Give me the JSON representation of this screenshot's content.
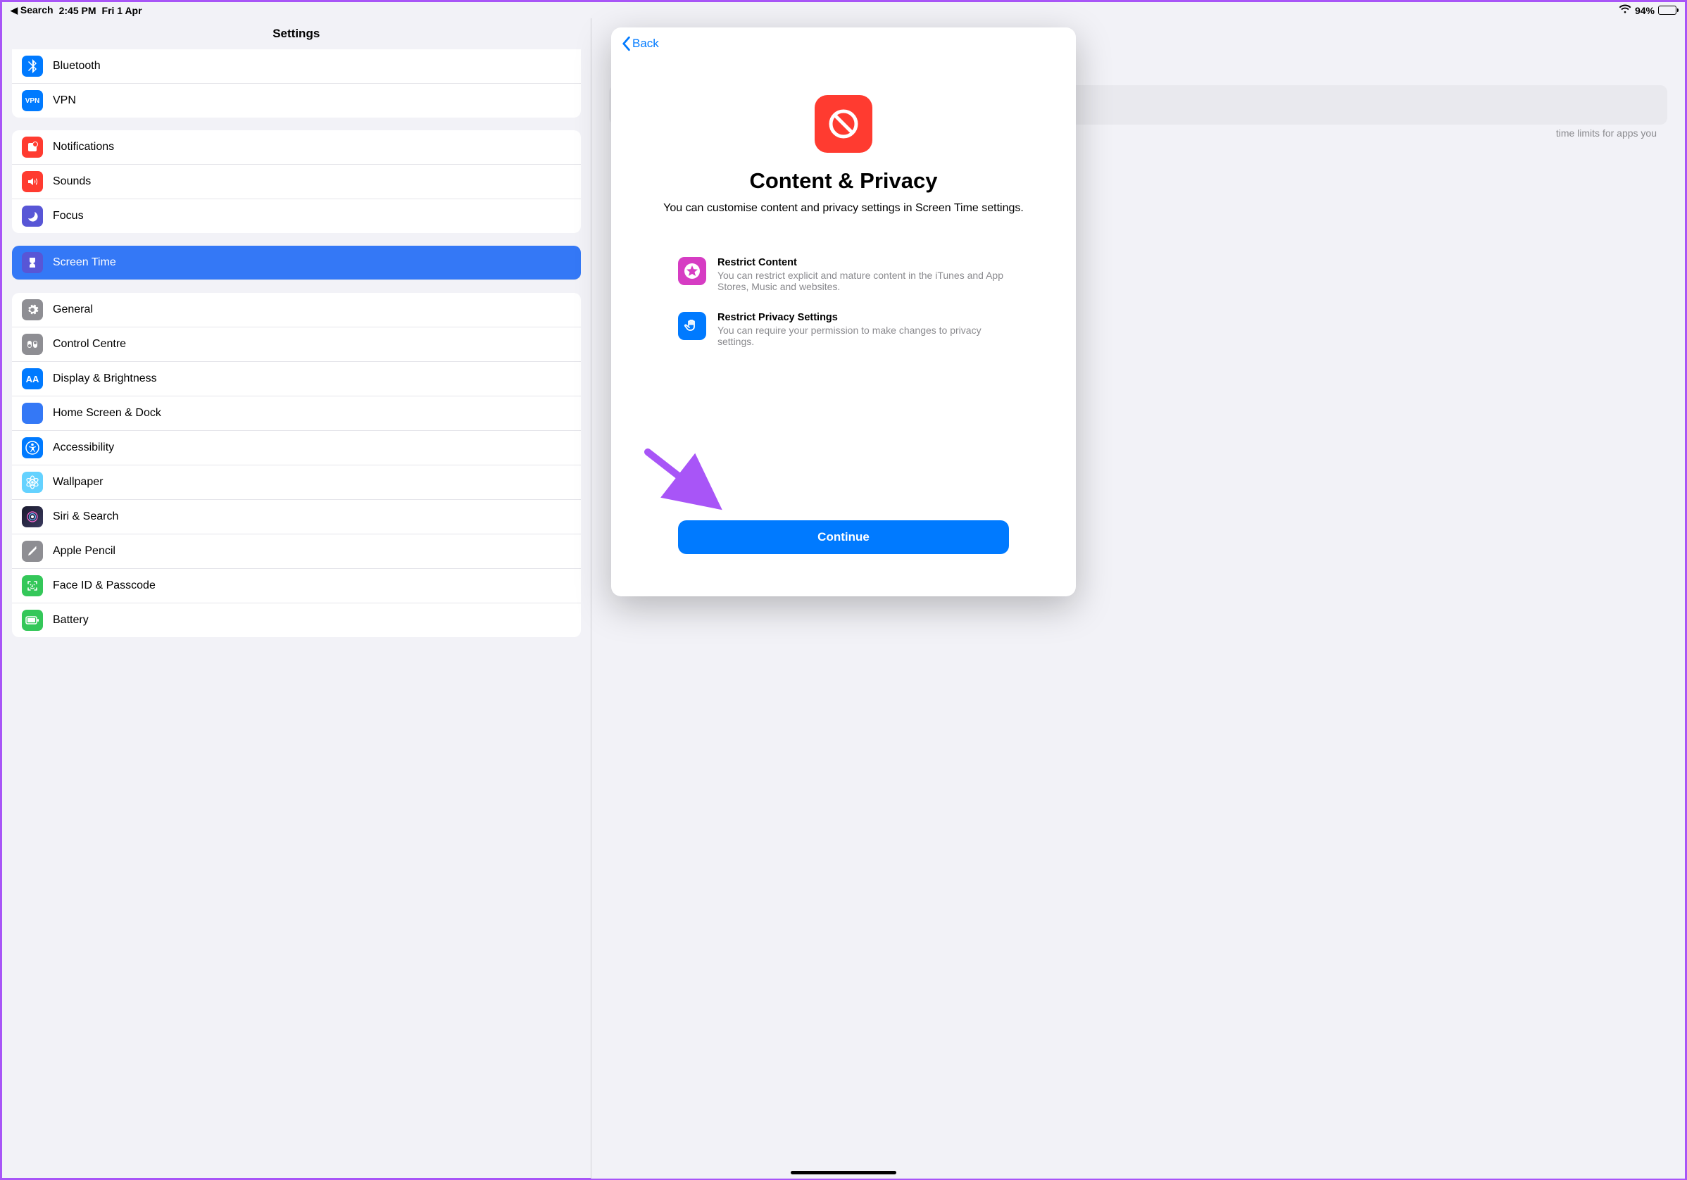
{
  "status": {
    "back_app": "Search",
    "time": "2:45 PM",
    "date": "Fri 1 Apr",
    "battery_pct": "94%"
  },
  "sidebar": {
    "title": "Settings",
    "group1": [
      {
        "label": "Bluetooth",
        "icon": "bluetooth"
      },
      {
        "label": "VPN",
        "icon": "vpn"
      }
    ],
    "group2": [
      {
        "label": "Notifications",
        "icon": "notifications"
      },
      {
        "label": "Sounds",
        "icon": "sounds"
      },
      {
        "label": "Focus",
        "icon": "focus"
      },
      {
        "label": "Screen Time",
        "icon": "screentime",
        "selected": true
      }
    ],
    "group3": [
      {
        "label": "General",
        "icon": "general"
      },
      {
        "label": "Control Centre",
        "icon": "controlcentre"
      },
      {
        "label": "Display & Brightness",
        "icon": "display"
      },
      {
        "label": "Home Screen & Dock",
        "icon": "homescreen"
      },
      {
        "label": "Accessibility",
        "icon": "accessibility"
      },
      {
        "label": "Wallpaper",
        "icon": "wallpaper"
      },
      {
        "label": "Siri & Search",
        "icon": "siri"
      },
      {
        "label": "Apple Pencil",
        "icon": "pencil"
      },
      {
        "label": "Face ID & Passcode",
        "icon": "faceid"
      },
      {
        "label": "Battery",
        "icon": "battery"
      }
    ]
  },
  "detail_bg": {
    "hint_text": "time limits for apps you"
  },
  "modal": {
    "back_label": "Back",
    "title": "Content & Privacy",
    "subtitle": "You can customise content and privacy settings in Screen Time settings.",
    "features": [
      {
        "title": "Restrict Content",
        "desc": "You can restrict explicit and mature content in the iTunes and App Stores, Music and websites."
      },
      {
        "title": "Restrict Privacy Settings",
        "desc": "You can require your permission to make changes to privacy settings."
      }
    ],
    "continue_label": "Continue"
  }
}
